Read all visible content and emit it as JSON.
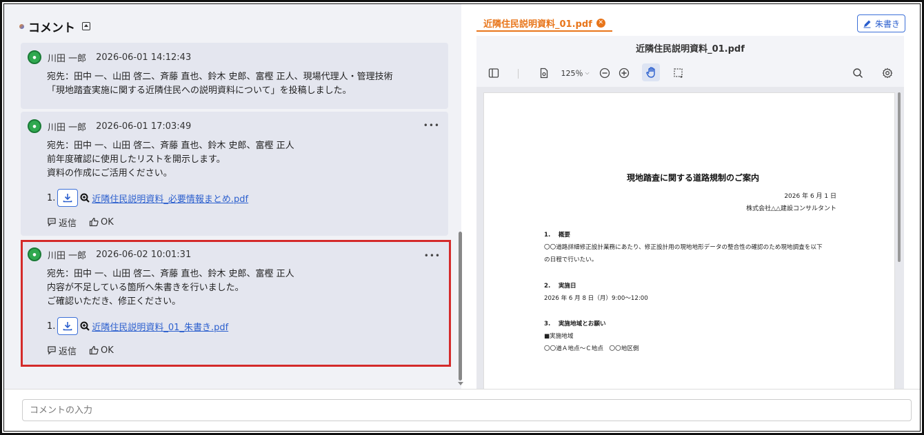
{
  "left_panel": {
    "title": "コメント"
  },
  "comments": [
    {
      "author": "川田 一郎",
      "timestamp": "2026-06-01 14:12:43",
      "lines": [
        "宛先：田中 一、山田 啓二、斉藤 直也、鈴木 史郎、富樫 正人、現場代理人・管理技術",
        "「現地踏査実施に関する近隣住民への説明資料について」を投稿しました。"
      ]
    },
    {
      "author": "川田 一郎",
      "timestamp": "2026-06-01 17:03:49",
      "lines": [
        "宛先：田中 一、山田 啓二、斉藤 直也、鈴木 史郎、富樫 正人",
        "前年度確認に使用したリストを開示します。",
        "資料の作成にご活用ください。"
      ],
      "attachment_index": "1.",
      "attachment_name": "近隣住民説明資料_必要情報まとめ.pdf",
      "reply_label": "返信",
      "ok_label": "OK"
    },
    {
      "author": "川田 一郎",
      "timestamp": "2026-06-02 10:01:31",
      "lines": [
        "宛先：田中 一、山田 啓二、斉藤 直也、鈴木 史郎、富樫 正人",
        "内容が不足している箇所へ朱書きを行いました。",
        "ご確認いただき、修正ください。"
      ],
      "attachment_index": "1.",
      "attachment_name": "近隣住民説明資料_01_朱書き.pdf",
      "reply_label": "返信",
      "ok_label": "OK"
    }
  ],
  "viewer": {
    "tab_label": "近隣住民説明資料_01.pdf",
    "markup_button": "朱書き",
    "file_title": "近隣住民説明資料_01.pdf",
    "zoom": "125％"
  },
  "document": {
    "title": "現地踏査に関する道路規制のご案内",
    "date": "2026 年 6 月 1 日",
    "company": "株式会社△△建設コンサルタント",
    "s1_heading": "1.　 概要",
    "s1_line1": "〇〇道路詳細修正設計業務にあたり、修正設計用の現地地形データの整合性の確認のため現地調査を以下",
    "s1_line2": "の日程で行いたい。",
    "s2_heading": "2.　 実施日",
    "s2_line1": "2026 年 6 月 8 日（月）9:00～12:00",
    "s3_heading": "3.　 実施地域とお願い",
    "s3_line1": "■実施地域",
    "s3_line2": "〇〇道Ａ地点～Ｃ地点　〇〇地区側"
  },
  "bottom": {
    "input_placeholder": "コメントの入力"
  }
}
